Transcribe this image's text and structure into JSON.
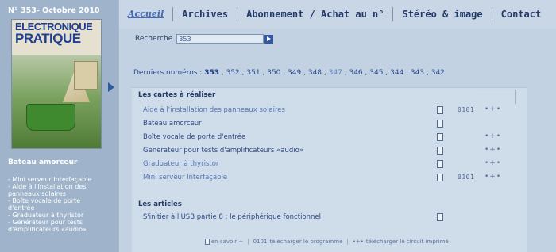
{
  "sidebar": {
    "issue_label": "N° 353- Octobre 2010",
    "cover": {
      "line1": "ELECTRONIQUE",
      "line2": "PRATIQUE"
    },
    "heading": "Bateau amorceur",
    "links": [
      "- Mini serveur Interfaçable",
      "- Aide à l'installation des",
      "panneaux solaires",
      "- Boîte vocale de porte",
      "d'entrée",
      "- Graduateur à thyristor",
      "- Générateur pour tests",
      "d'amplificateurs «audio»"
    ]
  },
  "nav": {
    "items": [
      "Accueil",
      "Archives",
      "Abonnement / Achat au n°",
      "Stéréo & image",
      "Contact"
    ]
  },
  "search": {
    "label": "Recherche",
    "value": "353"
  },
  "issues": {
    "label": "Derniers numéros :",
    "current": "353",
    "list": [
      "352",
      "351",
      "350",
      "349",
      "348",
      "347",
      "346",
      "345",
      "344",
      "343",
      "342"
    ]
  },
  "sections": {
    "cards_title": "Les cartes à réaliser",
    "articles_title": "Les articles"
  },
  "cards": [
    {
      "title": "Aide à l'installation des panneaux solaires",
      "faded": true,
      "doc": true,
      "prog": "0101",
      "circuit": "•+•"
    },
    {
      "title": "Bateau amorceur",
      "faded": false,
      "doc": true,
      "prog": "",
      "circuit": ""
    },
    {
      "title": "Boîte vocale de porte d'entrée",
      "faded": false,
      "doc": true,
      "prog": "",
      "circuit": "•+•"
    },
    {
      "title": "Générateur pour tests d'amplificateurs «audio»",
      "faded": false,
      "doc": true,
      "prog": "",
      "circuit": "•+•"
    },
    {
      "title": "Graduateur à thyristor",
      "faded": true,
      "doc": true,
      "prog": "",
      "circuit": "•+•"
    },
    {
      "title": "Mini serveur Interfaçable",
      "faded": true,
      "doc": true,
      "prog": "0101",
      "circuit": "•+•"
    }
  ],
  "articles": [
    {
      "title": "S'initier à l'USB partie 8 : le périphérique fonctionnel",
      "doc": true
    }
  ],
  "legend": {
    "doc_label": "en savoir +",
    "prog_code": "0101",
    "prog_label": "télécharger le programme",
    "circuit_label": "télécharger le circuit imprimé"
  },
  "colors": {
    "sidebar_bg": "#9fb4cb",
    "main_bg": "#c3d2e2",
    "accent": "#3558a3"
  }
}
